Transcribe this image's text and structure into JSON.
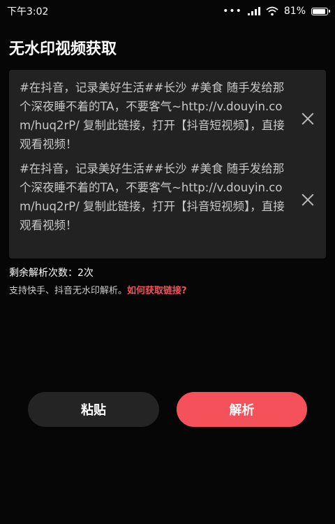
{
  "status_bar": {
    "time": "下午3:02",
    "battery_text": "81%"
  },
  "page": {
    "title": "无水印视频获取"
  },
  "links": [
    {
      "text": "#在抖音，记录美好生活##长沙 #美食 随手发给那个深夜睡不着的TA，不要客气~http://v.douyin.com/huq2rP/ 复制此链接，打开【抖音短视频】，直接观看视频！"
    },
    {
      "text": "#在抖音，记录美好生活##长沙 #美食 随手发给那个深夜睡不着的TA，不要客气~http://v.douyin.com/huq2rP/ 复制此链接，打开【抖音短视频】，直接观看视频！"
    }
  ],
  "info": {
    "remaining": "剩余解析次数：2次",
    "support": "支持快手、抖音无水印解析。",
    "help_link": "如何获取链接?"
  },
  "buttons": {
    "paste": "粘贴",
    "parse": "解析"
  },
  "colors": {
    "accent": "#f4515a",
    "background": "#060606",
    "card": "#222222"
  }
}
